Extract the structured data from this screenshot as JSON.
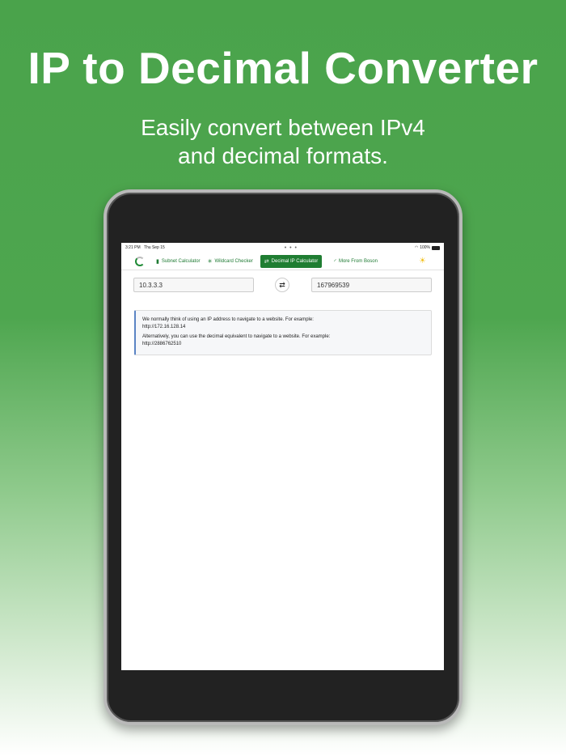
{
  "promo": {
    "headline": "IP to Decimal Converter",
    "subline_1": "Easily convert between IPv4",
    "subline_2": "and decimal formats."
  },
  "status_bar": {
    "time": "3:21 PM",
    "date": "Thu Sep 15",
    "dots": "• • •",
    "battery": "100%"
  },
  "navbar": {
    "items": [
      {
        "label": "Subnet Calculator",
        "icon": "calculator-icon"
      },
      {
        "label": "Wildcard Checker",
        "icon": "asterisk-icon"
      },
      {
        "label": "Decimal IP Calculator",
        "icon": "swap-icon",
        "active": true
      },
      {
        "label": "More From Boson",
        "icon": "boson-logo-icon"
      }
    ]
  },
  "converter": {
    "ip_value": "10.3.3.3",
    "decimal_value": "167969539"
  },
  "info": {
    "line1": "We normally think of using an IP address to navigate to a website. For example:",
    "line2": "http://172.16.128.14",
    "line3": "Alternatively, you can use the decimal equivalent to navigate to a website. For example:",
    "line4": "http://2886762510"
  },
  "colors": {
    "brand_green": "#1f7d32",
    "background_green": "#4aa34b",
    "info_accent": "#5b84c4",
    "sun": "#f2c01e"
  }
}
